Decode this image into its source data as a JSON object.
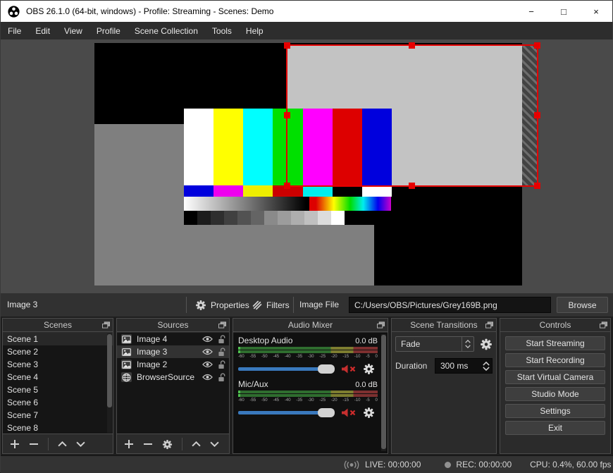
{
  "window": {
    "title": "OBS 26.1.0 (64-bit, windows) - Profile: Streaming - Scenes: Demo",
    "minimize_glyph": "−",
    "maximize_glyph": "□",
    "close_glyph": "×"
  },
  "menu": [
    "File",
    "Edit",
    "View",
    "Profile",
    "Scene Collection",
    "Tools",
    "Help"
  ],
  "source_toolbar": {
    "source_name": "Image 3",
    "properties": "Properties",
    "filters": "Filters",
    "image_file_label": "Image File",
    "image_file_value": "C:/Users/OBS/Pictures/Grey169B.png",
    "browse": "Browse"
  },
  "scenes": {
    "title": "Scenes",
    "items": [
      "Scene 1",
      "Scene 2",
      "Scene 3",
      "Scene 4",
      "Scene 5",
      "Scene 6",
      "Scene 7",
      "Scene 8"
    ],
    "selected": "Scene 1"
  },
  "sources": {
    "title": "Sources",
    "items": [
      {
        "name": "Image 4",
        "icon": "image-icon"
      },
      {
        "name": "Image 3",
        "icon": "image-icon",
        "selected": true
      },
      {
        "name": "Image 2",
        "icon": "image-icon"
      },
      {
        "name": "BrowserSource",
        "icon": "globe-icon"
      }
    ]
  },
  "mixer": {
    "title": "Audio Mixer",
    "channels": [
      {
        "name": "Desktop Audio",
        "db": "0.0 dB",
        "muted": true
      },
      {
        "name": "Mic/Aux",
        "db": "0.0 dB",
        "muted": true
      }
    ],
    "ticks": [
      "-60",
      "-55",
      "-50",
      "-45",
      "-40",
      "-35",
      "-30",
      "-25",
      "-20",
      "-15",
      "-10",
      "-5",
      "0"
    ]
  },
  "transitions": {
    "title": "Scene Transitions",
    "selected": "Fade",
    "duration_label": "Duration",
    "duration": "300 ms"
  },
  "controls": {
    "title": "Controls",
    "buttons": [
      "Start Streaming",
      "Start Recording",
      "Start Virtual Camera",
      "Studio Mode",
      "Settings",
      "Exit"
    ]
  },
  "status": {
    "live": "LIVE: 00:00:00",
    "rec": "REC: 00:00:00",
    "cpu": "CPU: 0.4%, 60.00 fps"
  },
  "colors": {
    "selection_red": "#e60000",
    "slider_blue": "#3a79bd",
    "canvas_mid_gray": "#7f7f7f",
    "canvas_light_gray": "#c3c3c3",
    "meter_green": "#2f6d2f",
    "meter_yellow": "#7d7d30",
    "meter_red": "#7d3030"
  }
}
